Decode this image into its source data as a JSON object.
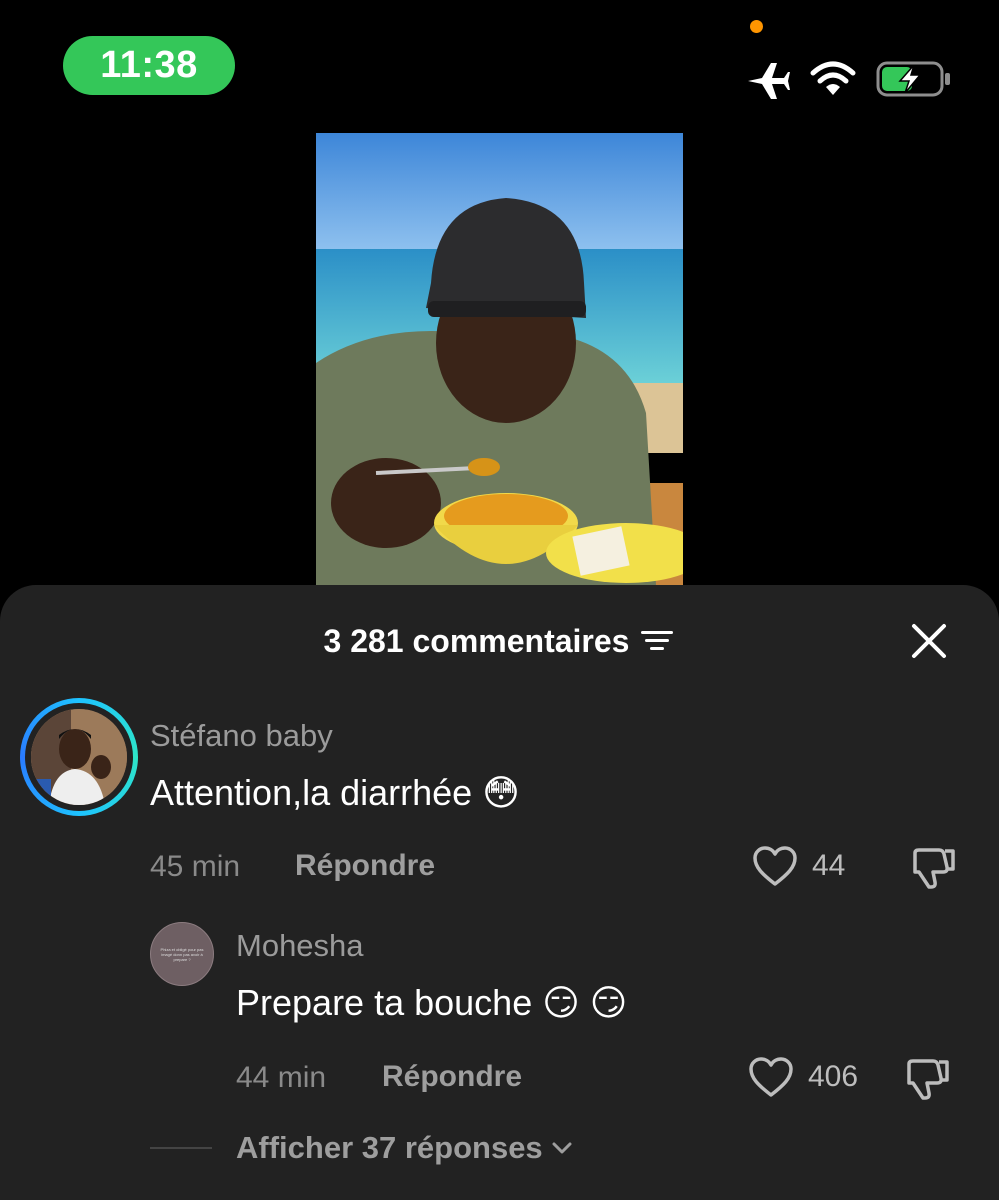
{
  "status_bar": {
    "time": "11:38",
    "icons": [
      "airplane-icon",
      "wifi-icon",
      "battery-charging-icon"
    ],
    "pill_color": "#34c759",
    "mic_dot_color": "#ff9500"
  },
  "video": {
    "description_icon": "video-thumbnail"
  },
  "sheet": {
    "comment_count": "3 281 commentaires",
    "filter_icon": "filter-icon",
    "close_icon": "close-icon"
  },
  "comments": [
    {
      "username": "Stéfano baby",
      "text": "Attention,la diarrhée 😳",
      "time": "45 min",
      "reply_label": "Répondre",
      "likes": "44"
    },
    {
      "username": "Mohesha",
      "text": "Prepare ta bouche 😏 😏",
      "time": "44 min",
      "reply_label": "Répondre",
      "likes": "406",
      "avatar_text": "Phiza et obligé pour pas imagé donn pas avoir à prepare ?"
    }
  ],
  "replies": {
    "label": "Afficher 37 réponses"
  }
}
